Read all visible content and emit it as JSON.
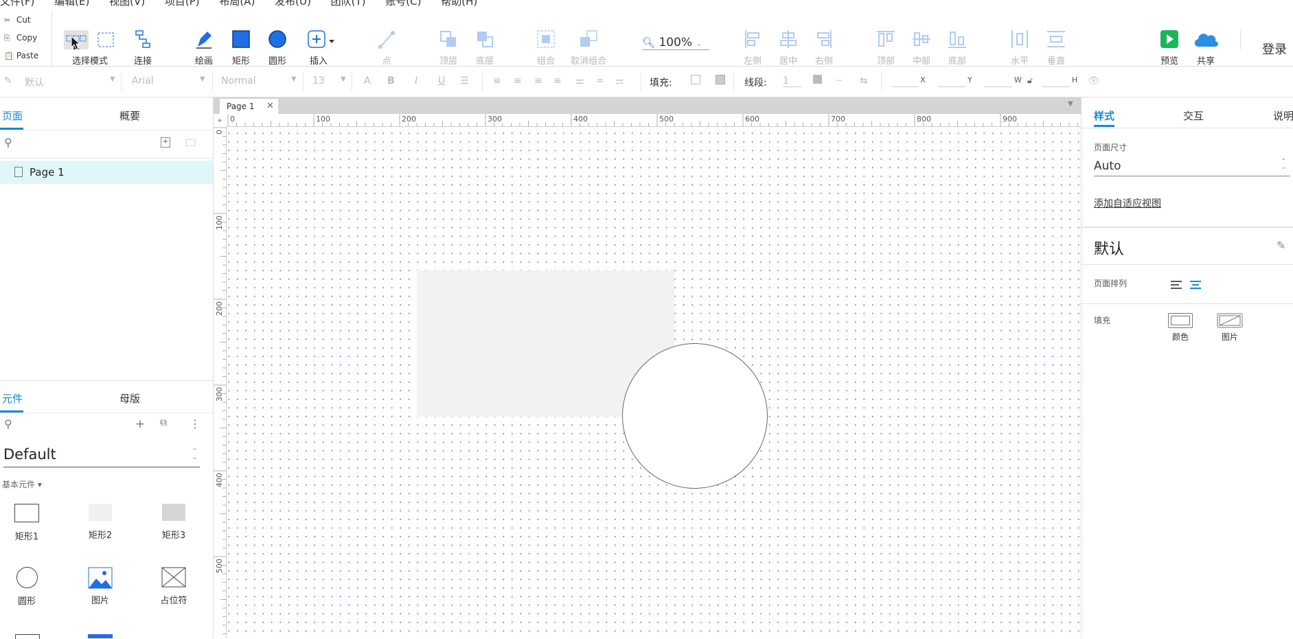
{
  "menu": [
    "文件(F)",
    "编辑(E)",
    "视图(V)",
    "项目(P)",
    "布局(A)",
    "发布(U)",
    "团队(T)",
    "账号(C)",
    "帮助(H)"
  ],
  "clipboard": {
    "cut": "Cut",
    "copy": "Copy",
    "paste": "Paste"
  },
  "toolbar": {
    "select_mode": "选择模式",
    "connect": "连接",
    "draw": "绘画",
    "rect": "矩形",
    "ellipse": "圆形",
    "insert": "插入",
    "point": "点",
    "top_layer": "顶层",
    "bottom_layer": "底层",
    "group": "组合",
    "ungroup": "取消组合",
    "zoom": "100%",
    "align_left": "左侧",
    "align_center": "居中",
    "align_right": "右侧",
    "align_top": "顶部",
    "align_middle": "中部",
    "align_bottom": "底部",
    "dist_h": "水平",
    "dist_v": "垂直",
    "preview": "预览",
    "share": "共享",
    "login": "登录"
  },
  "format": {
    "style": "默认",
    "font": "Arial",
    "weight": "Normal",
    "size": "13",
    "fill_label": "填充:",
    "line_label": "线段:",
    "line_value": "1",
    "x": "X",
    "y": "Y",
    "w": "W",
    "h": "H"
  },
  "left": {
    "tab_pages": "页面",
    "tab_outline": "概要",
    "page1": "Page 1",
    "tab_widgets": "元件",
    "tab_masters": "母版",
    "library": "Default",
    "category": "基本元件 ▾",
    "widgets": [
      "矩形1",
      "矩形2",
      "矩形3",
      "圆形",
      "图片",
      "占位符"
    ]
  },
  "canvas": {
    "page_tab": "Page 1",
    "h_ticks": [
      "0",
      "100",
      "200",
      "300",
      "400",
      "500",
      "600",
      "700",
      "800",
      "900"
    ],
    "v_ticks": [
      "0",
      "100",
      "200",
      "300",
      "400",
      "500"
    ]
  },
  "right": {
    "tab_style": "样式",
    "tab_interact": "交互",
    "tab_notes": "说明",
    "page_size_label": "页面尺寸",
    "page_size_value": "Auto",
    "adaptive_link": "添加自适应视图",
    "style_name": "默认",
    "page_align_label": "页面排列",
    "fill_label": "填充",
    "fill_color": "颜色",
    "fill_image": "图片"
  },
  "colors": {
    "accent": "#1589d6",
    "preview_green": "#1bb55c",
    "share_blue": "#2b8fe0",
    "shape_blue": "#1f6fe5"
  }
}
